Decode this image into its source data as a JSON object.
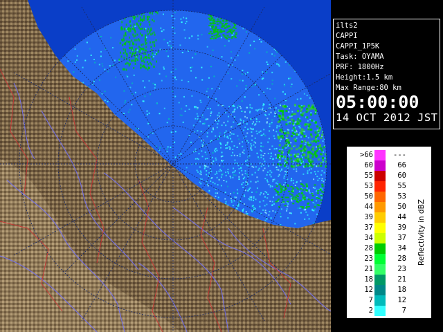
{
  "info": {
    "lines": [
      "ilts2",
      "CAPPI",
      "CAPPI_1P5K",
      "Task: OYAMA",
      "PRF: 1800Hz",
      "Height:1.5 km",
      "Max Range:80 km"
    ],
    "time": "05:00:00",
    "date": "14 OCT 2012 JST"
  },
  "legend": {
    "caption": "Reflectivity in dBZ",
    "rows": [
      {
        "lo": ">66",
        "hi": "---",
        "color": "#ff33ff"
      },
      {
        "lo": "60",
        "hi": "66",
        "color": "#cc00cc"
      },
      {
        "lo": "55",
        "hi": "60",
        "color": "#cc0000"
      },
      {
        "lo": "53",
        "hi": "55",
        "color": "#ff2200"
      },
      {
        "lo": "50",
        "hi": "53",
        "color": "#ff6600"
      },
      {
        "lo": "44",
        "hi": "50",
        "color": "#ff9900"
      },
      {
        "lo": "39",
        "hi": "44",
        "color": "#ffcc00"
      },
      {
        "lo": "37",
        "hi": "39",
        "color": "#ffff00"
      },
      {
        "lo": "34",
        "hi": "37",
        "color": "#ccff00"
      },
      {
        "lo": "28",
        "hi": "34",
        "color": "#00cc00"
      },
      {
        "lo": "23",
        "hi": "28",
        "color": "#00ff33"
      },
      {
        "lo": "21",
        "hi": "23",
        "color": "#33ff66"
      },
      {
        "lo": "18",
        "hi": "21",
        "color": "#009966"
      },
      {
        "lo": "12",
        "hi": "18",
        "color": "#008888"
      },
      {
        "lo": "7",
        "hi": "12",
        "color": "#00bbbb"
      },
      {
        "lo": "2",
        "hi": "7",
        "color": "#33ffff"
      }
    ]
  },
  "map_colors": {
    "sea": "#0a3ec8",
    "radar_coverage": "#2266ee",
    "land": "#7a6548",
    "land_dark": "#4a3a25",
    "land_light": "#b09a72",
    "rivers": "#7070ff",
    "boundaries": "#cc3333",
    "range_rings": "#1a2a66"
  }
}
